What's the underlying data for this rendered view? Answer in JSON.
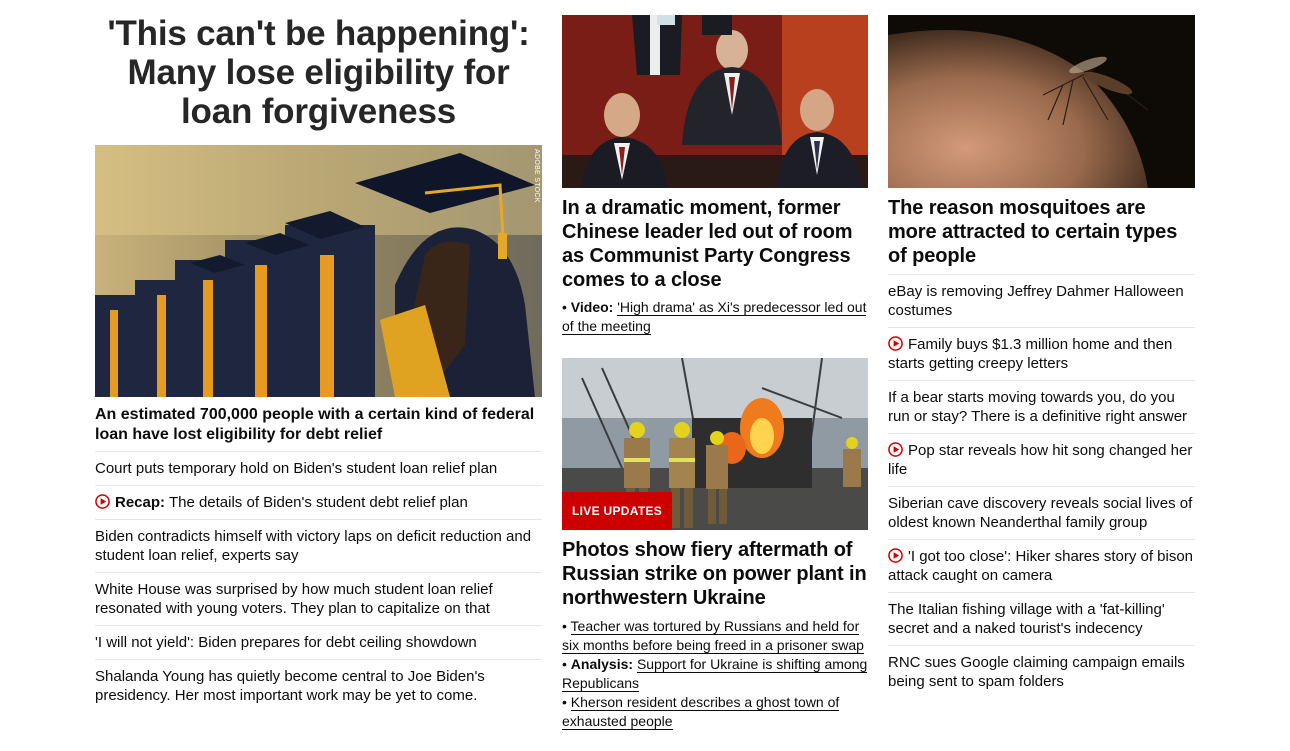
{
  "col1": {
    "headline": "'This can't be happening': Many lose eligibility for loan forgiveness",
    "image_credit": "ADOBE STOCK",
    "lead": "An estimated 700,000 people with a certain kind of federal loan have lost eligibility for debt relief",
    "items": [
      {
        "label": "",
        "text": "Court puts temporary hold on Biden's student loan relief plan",
        "video": false
      },
      {
        "label": "Recap:",
        "text": "The details of Biden's student debt relief plan",
        "video": true
      },
      {
        "label": "",
        "text": "Biden contradicts himself with victory laps on deficit reduction and student loan relief, experts say",
        "video": false
      },
      {
        "label": "",
        "text": "White House was surprised by how much student loan relief resonated with young voters. They plan to capitalize on that",
        "video": false
      },
      {
        "label": "",
        "text": "'I will not yield': Biden prepares for debt ceiling showdown",
        "video": false
      },
      {
        "label": "",
        "text": "Shalanda Young has quietly become central to Joe Biden's presidency. Her most important work may be yet to come.",
        "video": false
      }
    ]
  },
  "col2": {
    "story1": {
      "headline": "In a dramatic moment, former Chinese leader led out of room as Communist Party Congress comes to a close",
      "bullet_label": "Video:",
      "bullet_text": "'High drama' as Xi's predecessor led out of the meeting"
    },
    "story2": {
      "badge": "LIVE UPDATES",
      "headline": "Photos show fiery aftermath of Russian strike on power plant in northwestern Ukraine",
      "bullets": [
        {
          "label": "",
          "text": "Teacher was tortured by Russians and held for six months before being freed in a prisoner swap"
        },
        {
          "label": "Analysis:",
          "text": "Support for Ukraine is shifting among Republicans"
        },
        {
          "label": "",
          "text": "Kherson resident describes a ghost town of exhausted people"
        }
      ]
    }
  },
  "col3": {
    "headline": "The reason mosquitoes are more attracted to certain types of people",
    "items": [
      {
        "text": "eBay is removing Jeffrey Dahmer Halloween costumes",
        "video": false
      },
      {
        "text": "Family buys $1.3 million home and then starts getting creepy letters",
        "video": true
      },
      {
        "text": "If a bear starts moving towards you, do you run or stay? There is a definitive right answer",
        "video": false
      },
      {
        "text": "Pop star reveals how hit song changed her life",
        "video": true
      },
      {
        "text": "Siberian cave discovery reveals social lives of oldest known Neanderthal family group",
        "video": false
      },
      {
        "text": "'I got too close': Hiker shares story of bison attack caught on camera",
        "video": true
      },
      {
        "text": "The Italian fishing village with a 'fat-killing' secret and a naked tourist's indecency",
        "video": false
      },
      {
        "text": "RNC sues Google claiming campaign emails being sent to spam folders",
        "video": false
      }
    ]
  },
  "colors": {
    "accent": "#cc0000",
    "text": "#0c0c0c",
    "divider": "#e6e6e6"
  }
}
